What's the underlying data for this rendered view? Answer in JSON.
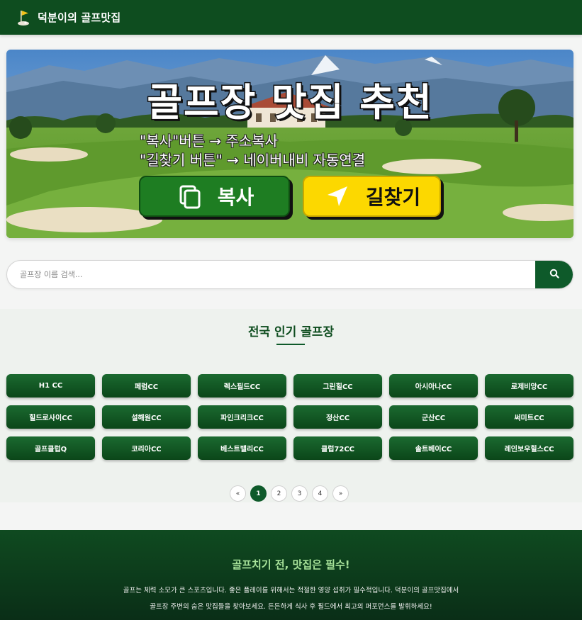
{
  "header": {
    "title": "덕분이의 골프맛집",
    "logo_icon": "golf-flag-icon"
  },
  "hero": {
    "title": "골프장 맛집 추천",
    "line1": "\"복사\"버튼  → 주소복사",
    "line2": "\"길찾기 버튼\" → 네이버내비 자동연결",
    "copy_label": "복사",
    "nav_label": "길찾기",
    "copy_icon": "copy-icon",
    "nav_icon": "navigation-arrow-icon"
  },
  "search": {
    "placeholder": "골프장 이름 검색...",
    "value": "",
    "icon": "search-icon"
  },
  "popular": {
    "title": "전국 인기 골프장",
    "courses": [
      "H1 CC",
      "페럼CC",
      "렉스필드CC",
      "그린힐CC",
      "아시아나CC",
      "로제비앙CC",
      "힐드로사이CC",
      "설해원CC",
      "파인크리크CC",
      "정산CC",
      "군산CC",
      "써미트CC",
      "골프클럽Q",
      "코리아CC",
      "베스트밸리CC",
      "클럽72CC",
      "솔트베이CC",
      "레인보우힐스CC"
    ]
  },
  "pagination": {
    "prev": "«",
    "pages": [
      "1",
      "2",
      "3",
      "4"
    ],
    "next": "»",
    "current": "1"
  },
  "footer": {
    "title": "골프치기 전, 맛집은 필수!",
    "line1": "골프는 체력 소모가 큰 스포츠입니다. 좋은 플레이를 위해서는 적절한 영양 섭취가 필수적입니다. 덕분이의 골프맛집에서",
    "line2": "골프장 주변의 숨은 맛집들을 찾아보세요. 든든하게 식사 후 필드에서 최고의 퍼포먼스를 발휘하세요!"
  },
  "colors": {
    "brand_green": "#0e4d1f",
    "copy_green": "#1e7d22",
    "nav_yellow": "#fcd800",
    "footer_accent": "#a8e39a"
  }
}
